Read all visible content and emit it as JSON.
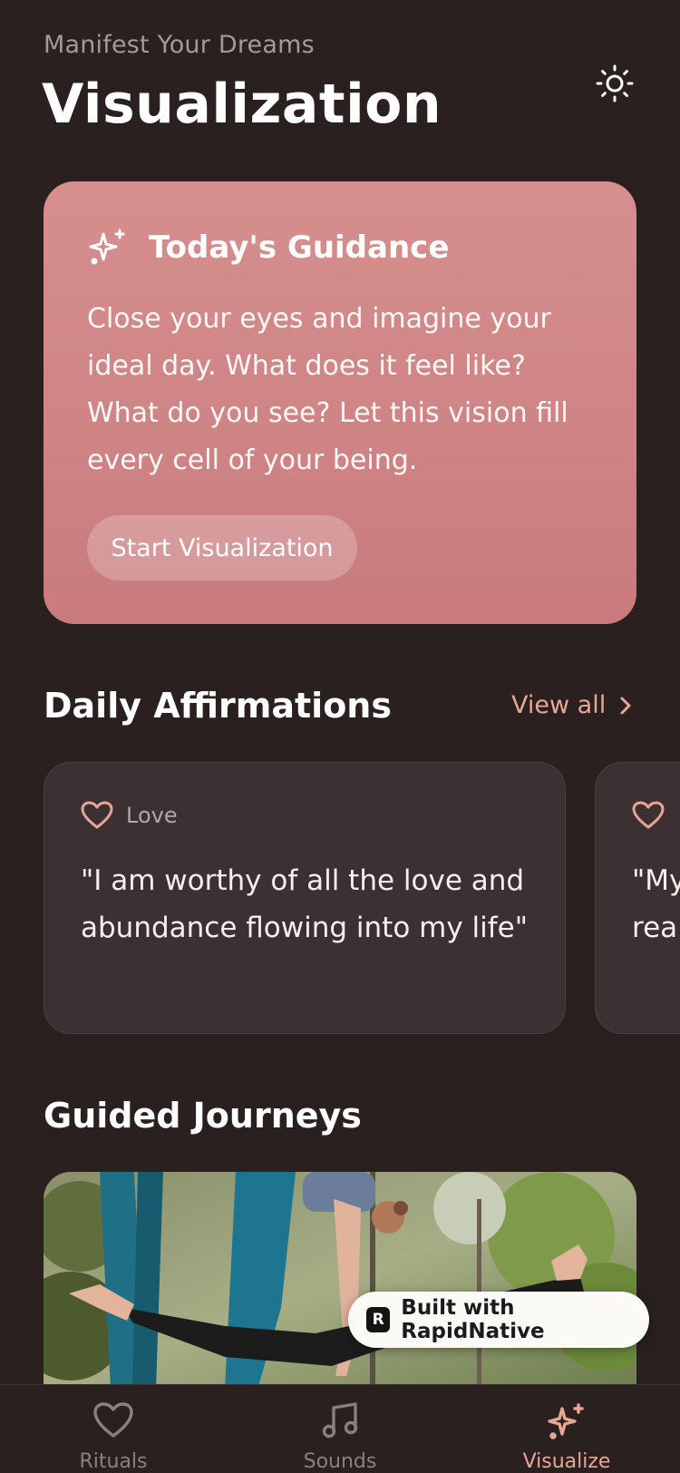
{
  "header": {
    "subtitle": "Manifest Your Dreams",
    "title": "Visualization",
    "theme_icon": "sun-icon"
  },
  "guidance": {
    "icon": "sparkles-icon",
    "title": "Today's Guidance",
    "text": "Close your eyes and imagine your ideal day. What does it feel like? What do you see? Let this vision fill every cell of your being.",
    "button_label": "Start Visualization"
  },
  "affirmations": {
    "title": "Daily Affirmations",
    "view_all": "View all",
    "cards": [
      {
        "category": "Love",
        "quote": "\"I am worthy of all the love and abundance flowing into my life\"",
        "icon": "heart-icon"
      },
      {
        "category": "",
        "quote": "\"My real",
        "icon": "heart-icon"
      }
    ]
  },
  "journeys": {
    "title": "Guided Journeys",
    "image": "aerial-yoga-photo"
  },
  "badge": {
    "label": "Built with RapidNative",
    "logo": "R"
  },
  "tabs": [
    {
      "label": "Rituals",
      "icon": "heart-icon",
      "active": false
    },
    {
      "label": "Sounds",
      "icon": "music-note-icon",
      "active": false
    },
    {
      "label": "Visualize",
      "icon": "sparkles-icon",
      "active": true
    }
  ],
  "colors": {
    "background": "#2a2020",
    "card_gradient_top": "#d68f8e",
    "card_gradient_bottom": "#c97b7d",
    "accent": "#e8a796",
    "affirmation_card": "#3c3032"
  }
}
